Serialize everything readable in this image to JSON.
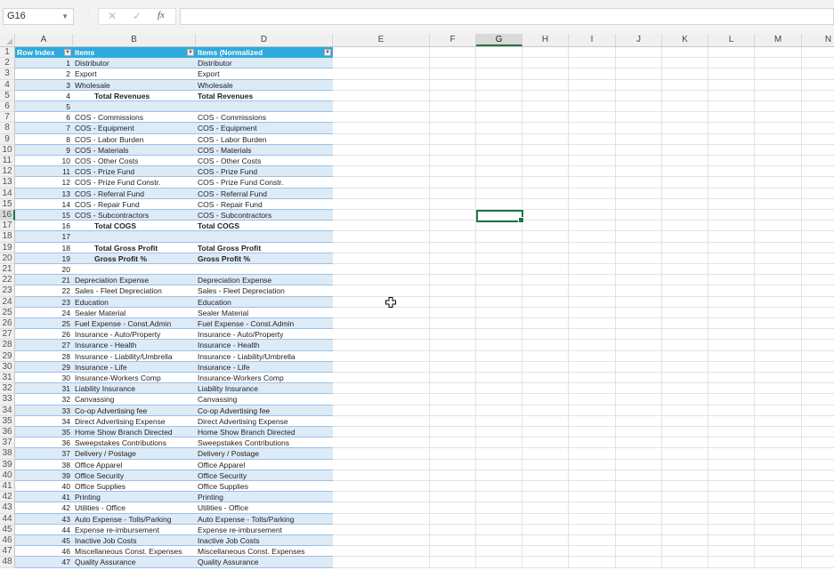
{
  "toolbar": {
    "name_box": "G16",
    "cancel_icon": "✕",
    "enter_icon": "✓",
    "fx_label": "fx",
    "formula_value": ""
  },
  "columns": [
    "A",
    "B",
    "D",
    "E",
    "F",
    "G",
    "H",
    "I",
    "J",
    "K",
    "L",
    "M",
    "N"
  ],
  "selected_cell": "G16",
  "table": {
    "headers": [
      "Row Index",
      "Items",
      "Items (Normalized"
    ],
    "rows": [
      {
        "row": "2",
        "idx": "1",
        "item": "Distributor",
        "norm": "Distributor",
        "bold": false
      },
      {
        "row": "3",
        "idx": "2",
        "item": "Export",
        "norm": "Export",
        "bold": false
      },
      {
        "row": "4",
        "idx": "3",
        "item": "Wholesale",
        "norm": "Wholesale",
        "bold": false
      },
      {
        "row": "5",
        "idx": "4",
        "item": "Total Revenues",
        "norm": "Total Revenues",
        "bold": true
      },
      {
        "row": "6",
        "idx": "5",
        "item": "",
        "norm": "",
        "bold": false
      },
      {
        "row": "7",
        "idx": "6",
        "item": "COS - Commissions",
        "norm": "COS - Commissions",
        "bold": false
      },
      {
        "row": "8",
        "idx": "7",
        "item": "COS - Equipment",
        "norm": "COS - Equipment",
        "bold": false
      },
      {
        "row": "9",
        "idx": "8",
        "item": "COS - Labor Burden",
        "norm": "COS - Labor Burden",
        "bold": false
      },
      {
        "row": "10",
        "idx": "9",
        "item": "COS - Materials",
        "norm": "COS - Materials",
        "bold": false
      },
      {
        "row": "11",
        "idx": "10",
        "item": "COS - Other Costs",
        "norm": "COS - Other Costs",
        "bold": false
      },
      {
        "row": "12",
        "idx": "11",
        "item": "COS - Prize Fund",
        "norm": "COS - Prize Fund",
        "bold": false
      },
      {
        "row": "13",
        "idx": "12",
        "item": "COS - Prize Fund Constr.",
        "norm": "COS - Prize Fund Constr.",
        "bold": false
      },
      {
        "row": "14",
        "idx": "13",
        "item": "COS - Referral Fund",
        "norm": "COS - Referral Fund",
        "bold": false
      },
      {
        "row": "15",
        "idx": "14",
        "item": "COS - Repair Fund",
        "norm": "COS - Repair Fund",
        "bold": false
      },
      {
        "row": "16",
        "idx": "15",
        "item": "COS - Subcontractors",
        "norm": "COS - Subcontractors",
        "bold": false
      },
      {
        "row": "17",
        "idx": "16",
        "item": "Total COGS",
        "norm": "Total COGS",
        "bold": true
      },
      {
        "row": "18",
        "idx": "17",
        "item": "",
        "norm": "",
        "bold": false
      },
      {
        "row": "19",
        "idx": "18",
        "item": "Total Gross Profit",
        "norm": "Total Gross Profit",
        "bold": true
      },
      {
        "row": "20",
        "idx": "19",
        "item": "Gross Profit %",
        "norm": "Gross Profit %",
        "bold": true
      },
      {
        "row": "21",
        "idx": "20",
        "item": "",
        "norm": "",
        "bold": false
      },
      {
        "row": "22",
        "idx": "21",
        "item": "Depreciation Expense",
        "norm": "Depreciation Expense",
        "bold": false
      },
      {
        "row": "23",
        "idx": "22",
        "item": "Sales - Fleet Depreciation",
        "norm": "Sales - Fleet Depreciation",
        "bold": false
      },
      {
        "row": "24",
        "idx": "23",
        "item": "Education",
        "norm": "Education",
        "bold": false
      },
      {
        "row": "25",
        "idx": "24",
        "item": "Sealer Material",
        "norm": "Sealer Material",
        "bold": false
      },
      {
        "row": "26",
        "idx": "25",
        "item": "Fuel Expense - Const.Admin",
        "norm": "Fuel Expense - Const.Admin",
        "bold": false
      },
      {
        "row": "27",
        "idx": "26",
        "item": "Insurance - Auto/Property",
        "norm": "Insurance - Auto/Property",
        "bold": false
      },
      {
        "row": "28",
        "idx": "27",
        "item": "Insurance - Health",
        "norm": "Insurance - Health",
        "bold": false
      },
      {
        "row": "29",
        "idx": "28",
        "item": "Insurance - Liability/Umbrella",
        "norm": "Insurance - Liability/Umbrella",
        "bold": false
      },
      {
        "row": "30",
        "idx": "29",
        "item": "Insurance - Life",
        "norm": "Insurance - Life",
        "bold": false
      },
      {
        "row": "31",
        "idx": "30",
        "item": "Insurance-Workers Comp",
        "norm": "Insurance-Workers Comp",
        "bold": false
      },
      {
        "row": "32",
        "idx": "31",
        "item": "Liability Insurance",
        "norm": "Liability Insurance",
        "bold": false
      },
      {
        "row": "33",
        "idx": "32",
        "item": "Canvassing",
        "norm": "Canvassing",
        "bold": false
      },
      {
        "row": "34",
        "idx": "33",
        "item": "Co-op Advertising fee",
        "norm": "Co-op Advertising fee",
        "bold": false
      },
      {
        "row": "35",
        "idx": "34",
        "item": "Direct Advertising Expense",
        "norm": "Direct Advertising Expense",
        "bold": false
      },
      {
        "row": "36",
        "idx": "35",
        "item": "Home Show Branch Directed",
        "norm": "Home Show Branch Directed",
        "bold": false
      },
      {
        "row": "37",
        "idx": "36",
        "item": "Sweepstakes Contributions",
        "norm": "Sweepstakes Contributions",
        "bold": false
      },
      {
        "row": "38",
        "idx": "37",
        "item": "Delivery / Postage",
        "norm": "Delivery / Postage",
        "bold": false
      },
      {
        "row": "39",
        "idx": "38",
        "item": "Office Apparel",
        "norm": "Office Apparel",
        "bold": false
      },
      {
        "row": "40",
        "idx": "39",
        "item": "Office Security",
        "norm": "Office Security",
        "bold": false
      },
      {
        "row": "41",
        "idx": "40",
        "item": "Office Supplies",
        "norm": "Office Supplies",
        "bold": false
      },
      {
        "row": "42",
        "idx": "41",
        "item": "Printing",
        "norm": "Printing",
        "bold": false
      },
      {
        "row": "43",
        "idx": "42",
        "item": "Utilities - Office",
        "norm": "Utilities - Office",
        "bold": false
      },
      {
        "row": "44",
        "idx": "43",
        "item": "Auto Expense - Tolls/Parking",
        "norm": "Auto Expense - Tolls/Parking",
        "bold": false
      },
      {
        "row": "45",
        "idx": "44",
        "item": "Expense re-imbursement",
        "norm": "Expense re-imbursement",
        "bold": false
      },
      {
        "row": "46",
        "idx": "45",
        "item": "Inactive Job Costs",
        "norm": "Inactive Job Costs",
        "bold": false
      },
      {
        "row": "47",
        "idx": "46",
        "item": "Miscellaneous Const. Expenses",
        "norm": "Miscellaneous Const. Expenses",
        "bold": false
      },
      {
        "row": "48",
        "idx": "47",
        "item": "Quality Assurance",
        "norm": "Quality Assurance",
        "bold": false
      }
    ]
  },
  "colors": {
    "table_header": "#2eaadc",
    "band": "#ddebf7",
    "selection": "#217346"
  }
}
